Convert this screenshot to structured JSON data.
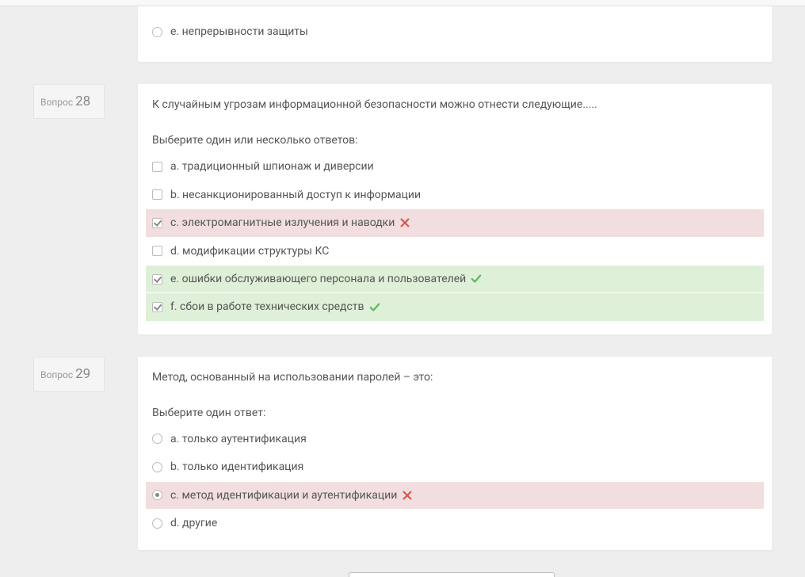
{
  "label_question": "Вопрос",
  "partial": {
    "option": {
      "letter": "e.",
      "text": "непрерывности защиты",
      "type": "radio",
      "checked": false,
      "status": ""
    }
  },
  "q28": {
    "number": "28",
    "text": "К случайным угрозам информационной безопасности можно отнести следующие.....",
    "instruction": "Выберите один или несколько ответов:",
    "options": [
      {
        "letter": "a.",
        "text": "традиционный шпионаж и диверсии",
        "type": "checkbox",
        "checked": false,
        "status": ""
      },
      {
        "letter": "b.",
        "text": "несанкционированный доступ к информации",
        "type": "checkbox",
        "checked": false,
        "status": ""
      },
      {
        "letter": "c.",
        "text": "электромагнитные излучения и наводки",
        "type": "checkbox",
        "checked": true,
        "status": "wrong"
      },
      {
        "letter": "d.",
        "text": "модификации структуры КС",
        "type": "checkbox",
        "checked": false,
        "status": ""
      },
      {
        "letter": "e.",
        "text": "ошибки обслуживающего персонала и пользователей",
        "type": "checkbox",
        "checked": true,
        "status": "right"
      },
      {
        "letter": "f.",
        "text": "сбои в работе технических средств",
        "type": "checkbox",
        "checked": true,
        "status": "right"
      }
    ]
  },
  "q29": {
    "number": "29",
    "text": "Метод, основанный на использовании паролей – это:",
    "instruction": "Выберите один ответ:",
    "options": [
      {
        "letter": "a.",
        "text": "только аутентификация",
        "type": "radio",
        "checked": false,
        "status": ""
      },
      {
        "letter": "b.",
        "text": "только идентификация",
        "type": "radio",
        "checked": false,
        "status": ""
      },
      {
        "letter": "c.",
        "text": "метод идентификации и аутентификации",
        "type": "radio",
        "checked": true,
        "status": "wrong"
      },
      {
        "letter": "d.",
        "text": "другие",
        "type": "radio",
        "checked": false,
        "status": ""
      }
    ]
  }
}
